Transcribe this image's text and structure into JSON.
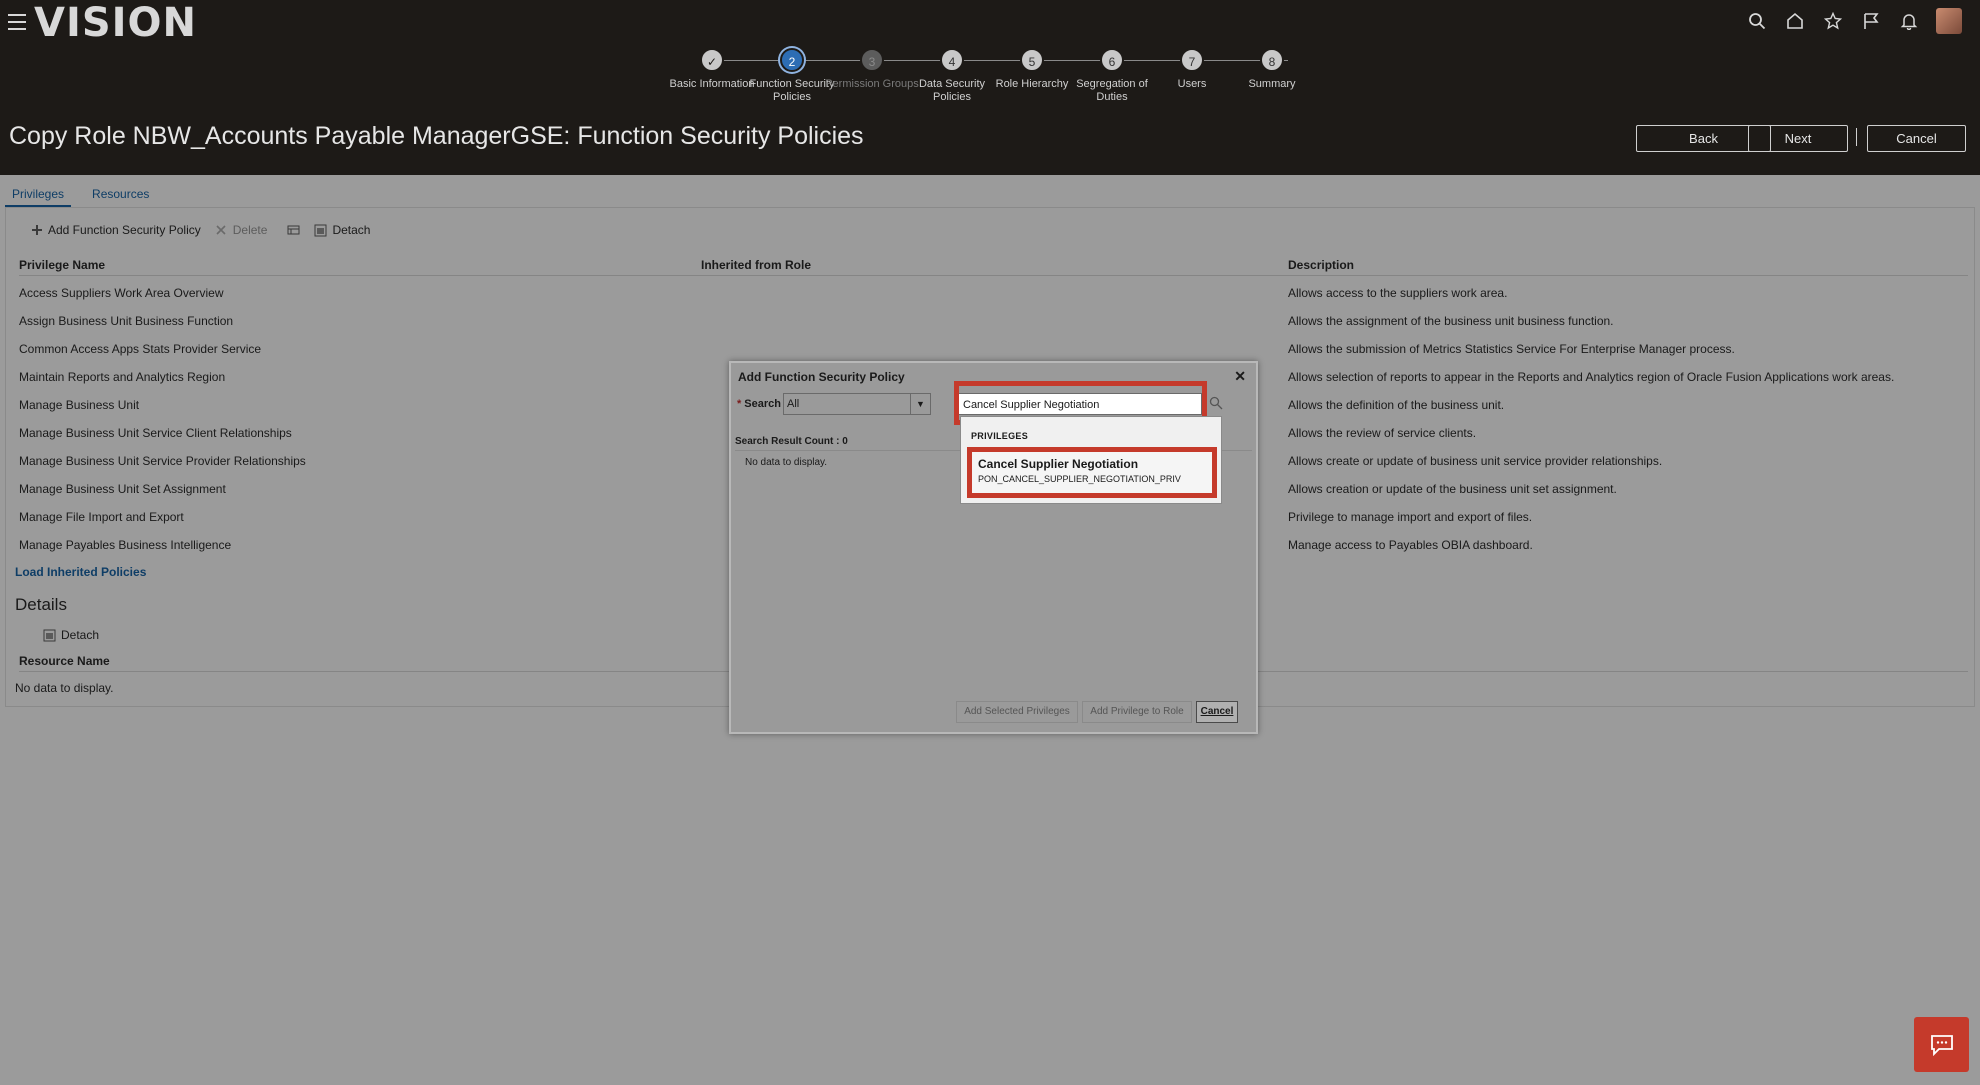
{
  "app": {
    "logo": "VISION"
  },
  "header_icons": [
    "search-icon",
    "home-icon",
    "star-icon",
    "flag-icon",
    "bell-icon"
  ],
  "train": [
    {
      "num": "✓",
      "label": "Basic Information",
      "state": "done"
    },
    {
      "num": "2",
      "label": "Function Security Policies",
      "state": "current"
    },
    {
      "num": "3",
      "label": "Permission Groups",
      "state": "disabled"
    },
    {
      "num": "4",
      "label": "Data Security Policies",
      "state": "todo"
    },
    {
      "num": "5",
      "label": "Role Hierarchy",
      "state": "todo"
    },
    {
      "num": "6",
      "label": "Segregation of Duties",
      "state": "todo"
    },
    {
      "num": "7",
      "label": "Users",
      "state": "todo"
    },
    {
      "num": "8",
      "label": "Summary",
      "state": "todo"
    }
  ],
  "page": {
    "title": "Copy Role NBW_Accounts Payable ManagerGSE: Function Security Policies",
    "back": "Back",
    "next": "Next",
    "cancel": "Cancel"
  },
  "tabs": [
    "Privileges",
    "Resources"
  ],
  "toolbar": {
    "add": "Add Function Security Policy",
    "delete": "Delete",
    "detach": "Detach"
  },
  "table": {
    "headers": [
      "Privilege Name",
      "Inherited from Role",
      "Description"
    ],
    "rows": [
      {
        "name": "Access Suppliers Work Area Overview",
        "inherited": "",
        "desc": "Allows access to the suppliers work area."
      },
      {
        "name": "Assign Business Unit Business Function",
        "inherited": "",
        "desc": "Allows the assignment of the business unit business function."
      },
      {
        "name": "Common Access Apps Stats Provider Service",
        "inherited": "",
        "desc": "Allows the submission of Metrics Statistics Service For Enterprise Manager process."
      },
      {
        "name": "Maintain Reports and Analytics Region",
        "inherited": "",
        "desc": "Allows selection of reports to appear in the Reports and Analytics region of Oracle Fusion Applications work areas."
      },
      {
        "name": "Manage Business Unit",
        "inherited": "",
        "desc": "Allows the definition of the business unit."
      },
      {
        "name": "Manage Business Unit Service Client Relationships",
        "inherited": "",
        "desc": "Allows the review of service clients."
      },
      {
        "name": "Manage Business Unit Service Provider Relationships",
        "inherited": "",
        "desc": "Allows create or update of business unit service provider relationships."
      },
      {
        "name": "Manage Business Unit Set Assignment",
        "inherited": "",
        "desc": "Allows creation or update of the business unit set assignment."
      },
      {
        "name": "Manage File Import and Export",
        "inherited": "",
        "desc": "Privilege to manage import and export of files."
      },
      {
        "name": "Manage Payables Business Intelligence",
        "inherited": "",
        "desc": "Manage access to Payables OBIA dashboard."
      }
    ]
  },
  "load_inherited": "Load Inherited Policies",
  "details": {
    "heading": "Details",
    "detach": "Detach",
    "header": "Resource Name",
    "empty": "No data to display."
  },
  "dialog": {
    "title": "Add Function Security Policy",
    "search_label": "Search",
    "search_scope": "All",
    "search_value": "Cancel Supplier Negotiation",
    "result_count": "Search Result Count : 0",
    "no_data": "No data to display.",
    "dropdown_group": "PRIVILEGES",
    "suggestion_title": "Cancel Supplier Negotiation",
    "suggestion_code": "PON_CANCEL_SUPPLIER_NEGOTIATION_PRIV",
    "btn_add_selected": "Add Selected Privileges",
    "btn_add_to_role": "Add Privilege to Role",
    "btn_cancel": "Cancel"
  },
  "colors": {
    "header_bg": "#1d1a17",
    "accent": "#2d6db4",
    "highlight": "#c53a2b"
  }
}
